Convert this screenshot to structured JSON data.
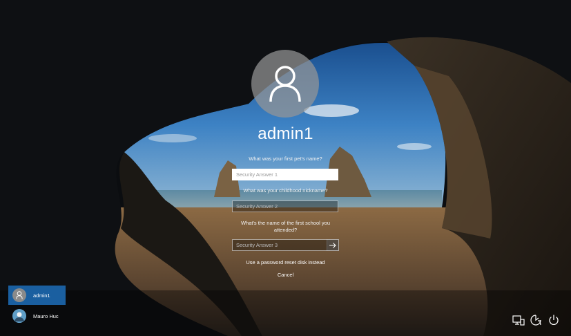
{
  "user": {
    "name": "admin1"
  },
  "questions": [
    {
      "label": "What was your first pet's name?",
      "placeholder": "Security Answer 1"
    },
    {
      "label": "What was your childhood nickname?",
      "placeholder": "Security Answer 2"
    },
    {
      "label": "What's the name of the first school you attended?",
      "placeholder": "Security Answer 3"
    }
  ],
  "links": {
    "reset_disk": "Use a password reset disk instead",
    "cancel": "Cancel"
  },
  "user_list": [
    {
      "name": "admin1",
      "selected": true
    },
    {
      "name": "Mauro Huc",
      "selected": false
    }
  ],
  "system_icons": [
    "network-icon",
    "ease-of-access-icon",
    "power-icon"
  ],
  "colors": {
    "selected_tile": "#1a5fa0"
  }
}
